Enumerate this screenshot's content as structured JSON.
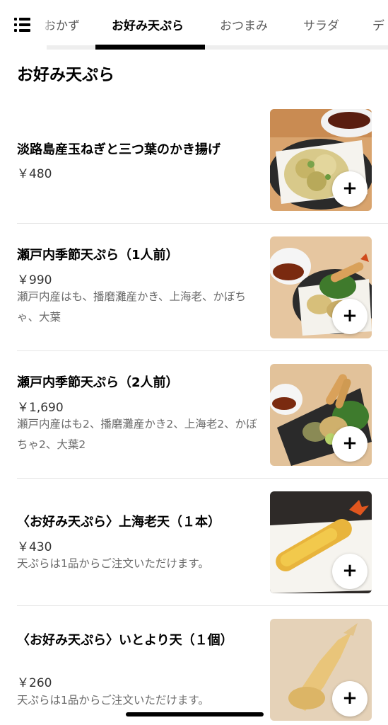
{
  "tabs": [
    {
      "label": "おかず",
      "active": false
    },
    {
      "label": "お好み天ぷら",
      "active": true
    },
    {
      "label": "おつまみ",
      "active": false
    },
    {
      "label": "サラダ",
      "active": false
    },
    {
      "label": "デ",
      "active": false
    }
  ],
  "section": {
    "title": "お好み天ぷら"
  },
  "items": [
    {
      "name": "淡路島産玉ねぎと三つ葉のかき揚げ",
      "price": "￥480",
      "desc": "",
      "add_label": "+"
    },
    {
      "name": "瀬戸内季節天ぷら（1人前）",
      "price": "￥990",
      "desc": "瀬戸内産はも、播磨灘産かき、上海老、かぼちゃ、大葉",
      "add_label": "+"
    },
    {
      "name": "瀬戸内季節天ぷら（2人前）",
      "price": "￥1,690",
      "desc": "瀬戸内産はも2、播磨灘産かき2、上海老2、かぼちゃ2、大葉2",
      "add_label": "+"
    },
    {
      "name": "〈お好み天ぷら〉上海老天（１本）",
      "price": "￥430",
      "desc": "天ぷらは1品からご注文いただけます。",
      "add_label": "+"
    },
    {
      "name": "〈お好み天ぷら〉いとより天（１個）",
      "price": "￥260",
      "desc": "天ぷらは1品からご注文いただけます。",
      "add_label": "+"
    }
  ],
  "icons": {
    "menu": "hamburger-list-icon",
    "add": "plus-icon"
  }
}
